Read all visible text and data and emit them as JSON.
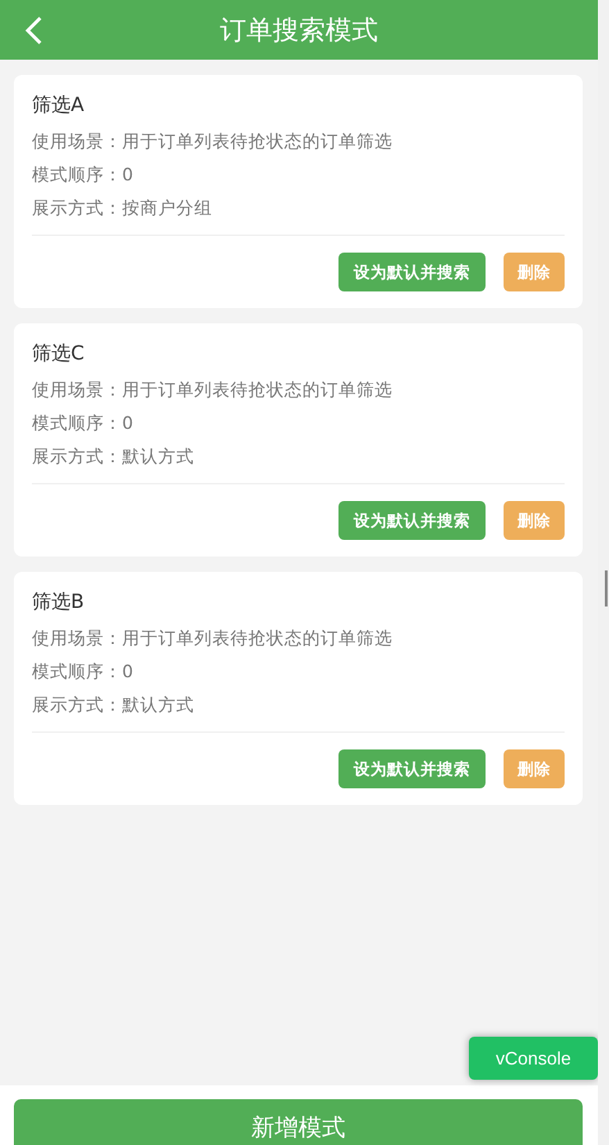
{
  "header": {
    "title": "订单搜索模式"
  },
  "modes": [
    {
      "name": "筛选A",
      "fields": [
        {
          "label": "使用场景：",
          "value": "用于订单列表待抢状态的订单筛选"
        },
        {
          "label": "模式顺序：",
          "value": "0"
        },
        {
          "label": "展示方式：",
          "value": "按商户分组"
        }
      ],
      "actions": [
        {
          "label": "设为默认并搜索",
          "kind": "primary"
        },
        {
          "label": "删除",
          "kind": "danger"
        }
      ]
    },
    {
      "name": "筛选C",
      "fields": [
        {
          "label": "使用场景：",
          "value": "用于订单列表待抢状态的订单筛选"
        },
        {
          "label": "模式顺序：",
          "value": "0"
        },
        {
          "label": "展示方式：",
          "value": "默认方式"
        }
      ],
      "actions": [
        {
          "label": "设为默认并搜索",
          "kind": "primary"
        },
        {
          "label": "删除",
          "kind": "danger"
        }
      ]
    },
    {
      "name": "筛选B",
      "fields": [
        {
          "label": "使用场景：",
          "value": "用于订单列表待抢状态的订单筛选"
        },
        {
          "label": "模式顺序：",
          "value": "0"
        },
        {
          "label": "展示方式：",
          "value": "默认方式"
        }
      ],
      "actions": [
        {
          "label": "设为默认并搜索",
          "kind": "primary"
        },
        {
          "label": "删除",
          "kind": "danger"
        }
      ]
    }
  ],
  "vconsole": "vConsole",
  "add_button": "新增模式"
}
